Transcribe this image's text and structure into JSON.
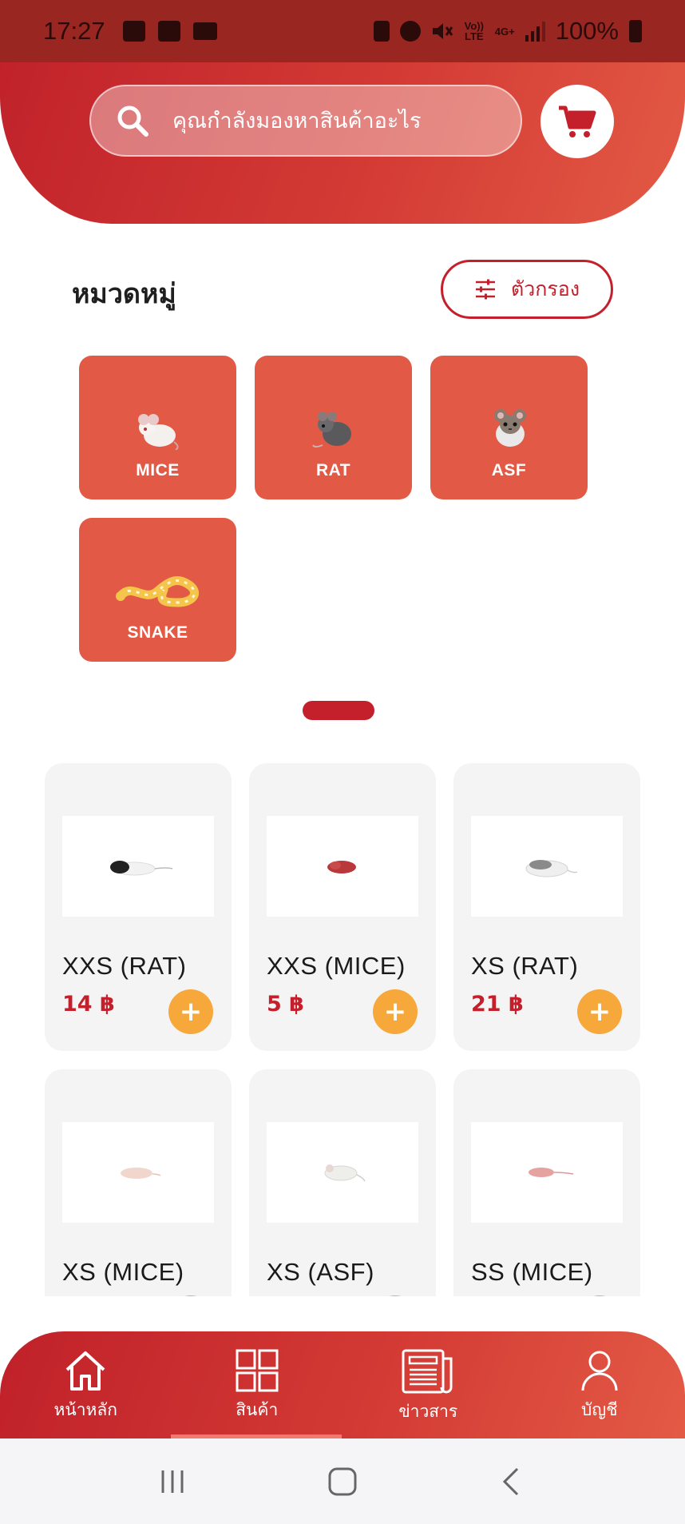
{
  "status_bar": {
    "time": "17:27",
    "left_icons": [
      "gallery-icon",
      "checkbox-icon",
      "folder-icon"
    ],
    "right_icons": [
      "battery-saver-icon",
      "alarm-icon",
      "mute-icon",
      "volte-icon",
      "4g-icon",
      "signal-icon"
    ],
    "volte_label": "Vo)) LTE",
    "network_label": "4G+",
    "battery": "100%"
  },
  "header": {
    "search_placeholder": "คุณกำลังมองหาสินค้าอะไร",
    "cart_icon": "cart-icon"
  },
  "categories_section": {
    "title": "หมวดหมู่",
    "filter_label": "ตัวกรอง",
    "items": [
      {
        "label": "MICE",
        "icon": "mouse-image"
      },
      {
        "label": "RAT",
        "icon": "rat-image"
      },
      {
        "label": "ASF",
        "icon": "asf-image"
      },
      {
        "label": "SNAKE",
        "icon": "snake-image"
      }
    ]
  },
  "products": [
    {
      "name": "XXS (RAT)",
      "price": "14 ฿",
      "add_label": "+"
    },
    {
      "name": "XXS (MICE)",
      "price": "5 ฿",
      "add_label": "+"
    },
    {
      "name": "XS (RAT)",
      "price": "21 ฿",
      "add_label": "+"
    },
    {
      "name": "XS (MICE)",
      "price": "",
      "add_label": "+"
    },
    {
      "name": "XS (ASF)",
      "price": "",
      "add_label": "+"
    },
    {
      "name": "SS (MICE)",
      "price": "",
      "add_label": "+"
    }
  ],
  "bottom_nav": {
    "items": [
      {
        "label": "หน้าหลัก",
        "icon": "home-icon"
      },
      {
        "label": "สินค้า",
        "icon": "grid-icon"
      },
      {
        "label": "ข่าวสาร",
        "icon": "newspaper-icon"
      },
      {
        "label": "บัญชี",
        "icon": "user-icon"
      }
    ],
    "active_index": 1
  },
  "system_nav": [
    "recents-icon",
    "home-circle-icon",
    "back-icon"
  ],
  "colors": {
    "primary": "#c4202c",
    "category_tile": "#e25a45",
    "add_button": "#f6a83a",
    "card_bg": "#f4f4f4"
  }
}
